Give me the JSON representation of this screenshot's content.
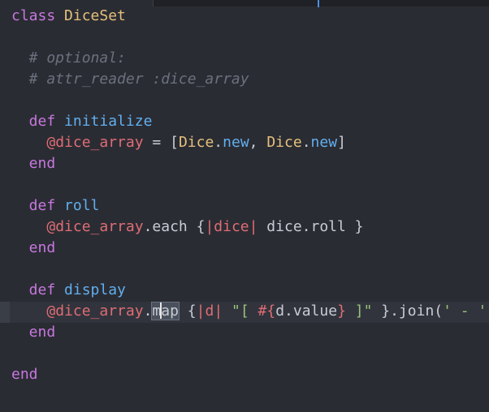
{
  "window": {
    "tab_label": "",
    "language": "Ruby"
  },
  "colors": {
    "background": "#2a2c33",
    "keyword": "#c678dd",
    "class_name": "#e5c07b",
    "function_name": "#61afef",
    "instance_variable": "#e06c75",
    "comment": "#6a717e",
    "string": "#98c379",
    "plain": "#c8ccd4"
  },
  "code": {
    "cursor_line": 15,
    "lines": [
      {
        "tokens": [
          {
            "t": "class",
            "c": "kw"
          },
          {
            "t": " ",
            "c": "pl"
          },
          {
            "t": "DiceSet",
            "c": "cls"
          }
        ]
      },
      {
        "tokens": []
      },
      {
        "tokens": [
          {
            "t": "  # optional:",
            "c": "cm"
          }
        ]
      },
      {
        "tokens": [
          {
            "t": "  # attr_reader :dice_array",
            "c": "cm"
          }
        ]
      },
      {
        "tokens": []
      },
      {
        "tokens": [
          {
            "t": "  def",
            "c": "kw"
          },
          {
            "t": " ",
            "c": "pl"
          },
          {
            "t": "initialize",
            "c": "fn"
          }
        ]
      },
      {
        "tokens": [
          {
            "t": "    ",
            "c": "pl"
          },
          {
            "t": "@dice_array",
            "c": "ivar"
          },
          {
            "t": " = [",
            "c": "pl"
          },
          {
            "t": "Dice",
            "c": "cls"
          },
          {
            "t": ".",
            "c": "pl"
          },
          {
            "t": "new",
            "c": "fn"
          },
          {
            "t": ", ",
            "c": "pl"
          },
          {
            "t": "Dice",
            "c": "cls"
          },
          {
            "t": ".",
            "c": "pl"
          },
          {
            "t": "new",
            "c": "fn"
          },
          {
            "t": "]",
            "c": "pl"
          }
        ]
      },
      {
        "tokens": [
          {
            "t": "  end",
            "c": "kw"
          }
        ]
      },
      {
        "tokens": []
      },
      {
        "tokens": [
          {
            "t": "  def",
            "c": "kw"
          },
          {
            "t": " ",
            "c": "pl"
          },
          {
            "t": "roll",
            "c": "fn"
          }
        ]
      },
      {
        "tokens": [
          {
            "t": "    ",
            "c": "pl"
          },
          {
            "t": "@dice_array",
            "c": "ivar"
          },
          {
            "t": ".each {",
            "c": "pl"
          },
          {
            "t": "|dice|",
            "c": "ivar"
          },
          {
            "t": " dice.roll }",
            "c": "pl"
          }
        ]
      },
      {
        "tokens": [
          {
            "t": "  end",
            "c": "kw"
          }
        ]
      },
      {
        "tokens": []
      },
      {
        "tokens": [
          {
            "t": "  def",
            "c": "kw"
          },
          {
            "t": " ",
            "c": "pl"
          },
          {
            "t": "display",
            "c": "fn"
          }
        ]
      },
      {
        "tokens": [
          {
            "t": "    ",
            "c": "pl"
          },
          {
            "t": "@dice_array",
            "c": "ivar"
          },
          {
            "t": ".",
            "c": "pl"
          },
          {
            "t": "map",
            "c": "pl",
            "sel": true
          },
          {
            "t": " {",
            "c": "pl"
          },
          {
            "t": "|d|",
            "c": "ivar"
          },
          {
            "t": " ",
            "c": "pl"
          },
          {
            "t": "\"[ ",
            "c": "str"
          },
          {
            "t": "#{",
            "c": "interp"
          },
          {
            "t": "d.value",
            "c": "pl"
          },
          {
            "t": "}",
            "c": "interp"
          },
          {
            "t": " ]\"",
            "c": "str"
          },
          {
            "t": " }.join(",
            "c": "pl"
          },
          {
            "t": "' - '",
            "c": "str"
          },
          {
            "t": ")",
            "c": "pl"
          }
        ]
      },
      {
        "tokens": [
          {
            "t": "  end",
            "c": "kw"
          }
        ]
      },
      {
        "tokens": []
      },
      {
        "tokens": [
          {
            "t": "end",
            "c": "kw"
          }
        ]
      }
    ]
  }
}
